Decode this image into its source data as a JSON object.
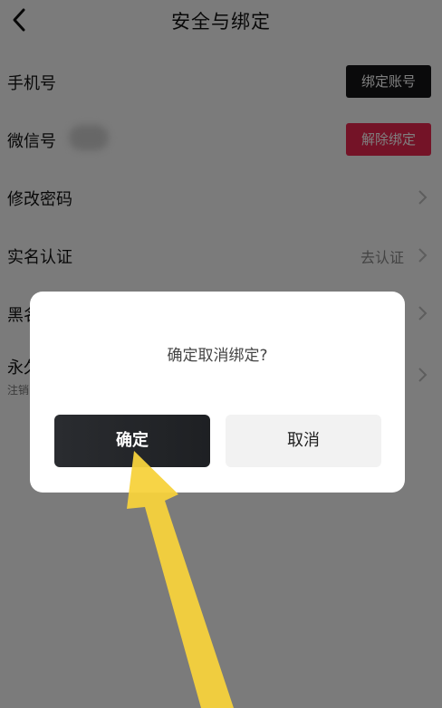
{
  "header": {
    "title": "安全与绑定",
    "back_icon": "chevron-left-icon"
  },
  "settings": {
    "phone": {
      "label": "手机号",
      "button": "绑定账号"
    },
    "wechat": {
      "label": "微信号",
      "button": "解除绑定"
    },
    "password": {
      "label": "修改密码"
    },
    "realname": {
      "label": "实名认证",
      "value": "去认证"
    },
    "blacklist": {
      "label": "黑名"
    },
    "permanent": {
      "label": "永久",
      "sub": "注销"
    }
  },
  "dialog": {
    "message": "确定取消绑定?",
    "confirm": "确定",
    "cancel": "取消"
  },
  "colors": {
    "accent_red": "#e8264f",
    "dark_button": "#151517",
    "arrow_yellow": "#f7d23c"
  }
}
